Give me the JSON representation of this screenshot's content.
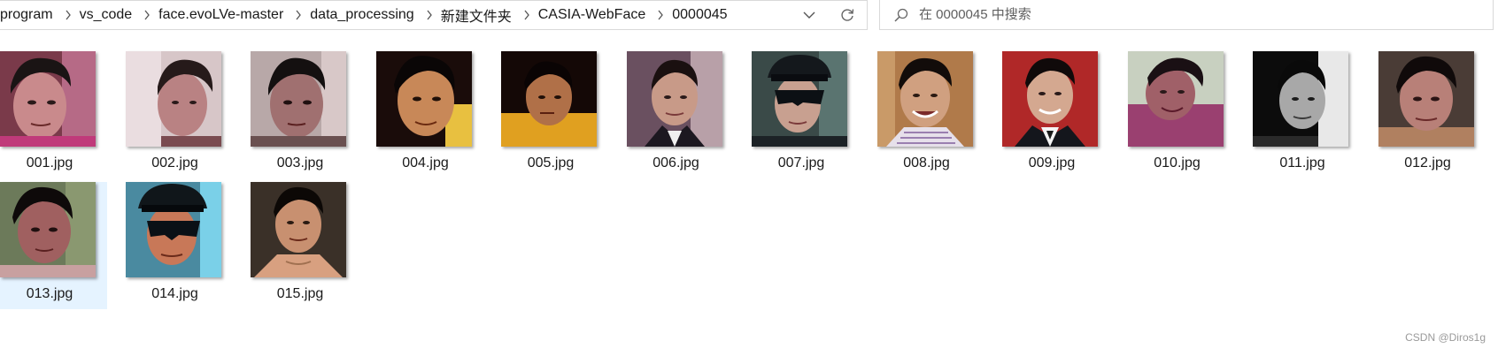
{
  "address_bar": {
    "breadcrumbs": [
      "program",
      "vs_code",
      "face.evoLVe-master",
      "data_processing",
      "新建文件夹",
      "CASIA-WebFace",
      "0000045"
    ],
    "separator_icon": "chevron-right-icon",
    "dropdown_icon": "chevron-down-icon",
    "refresh_icon": "refresh-icon"
  },
  "search": {
    "icon": "search-icon",
    "placeholder": "在 0000045 中搜索",
    "value": ""
  },
  "files": [
    {
      "name": "001.jpg",
      "selected": false
    },
    {
      "name": "002.jpg",
      "selected": false
    },
    {
      "name": "003.jpg",
      "selected": false
    },
    {
      "name": "004.jpg",
      "selected": false
    },
    {
      "name": "005.jpg",
      "selected": false
    },
    {
      "name": "006.jpg",
      "selected": false
    },
    {
      "name": "007.jpg",
      "selected": false
    },
    {
      "name": "008.jpg",
      "selected": false
    },
    {
      "name": "009.jpg",
      "selected": false
    },
    {
      "name": "010.jpg",
      "selected": false
    },
    {
      "name": "011.jpg",
      "selected": false
    },
    {
      "name": "012.jpg",
      "selected": false
    },
    {
      "name": "013.jpg",
      "selected": true
    },
    {
      "name": "014.jpg",
      "selected": false
    },
    {
      "name": "015.jpg",
      "selected": false
    }
  ],
  "watermark": "CSDN @Diros1g",
  "colors": {
    "selection": "#e5f3ff",
    "border": "#d9d9d9"
  }
}
